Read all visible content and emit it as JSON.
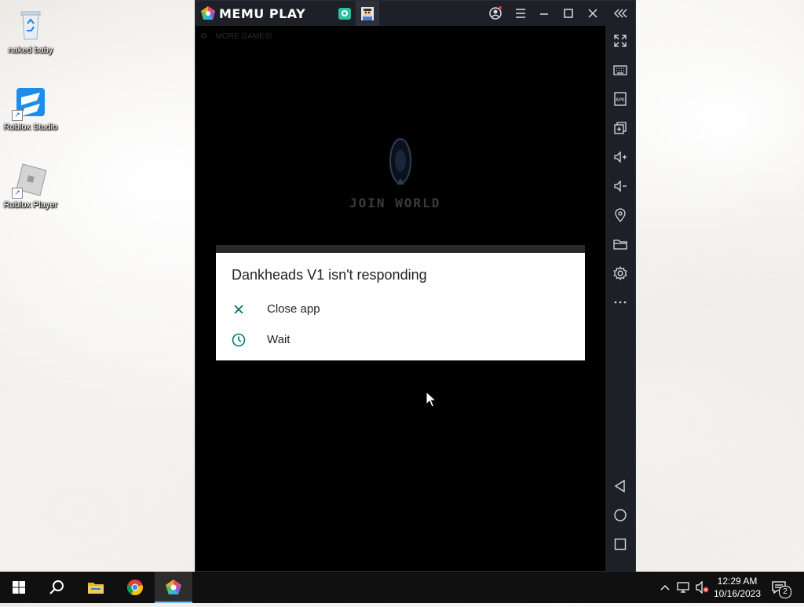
{
  "desktop": {
    "icons": [
      {
        "label": "naked baby",
        "icon": "recycle-bin-icon"
      },
      {
        "label": "Roblox Studio",
        "icon": "roblox-studio-icon"
      },
      {
        "label": "Roblox Player",
        "icon": "roblox-player-icon"
      }
    ]
  },
  "emulator": {
    "brand": "MEMU PLAY",
    "titlebar_buttons": [
      "account-icon",
      "menu-icon",
      "minimize-icon",
      "maximize-icon",
      "close-icon",
      "collapse-sidebar-icon"
    ],
    "sidebar_buttons": [
      "fullscreen-icon",
      "keyboard-icon",
      "apk-icon",
      "multi-instance-icon",
      "volume-up-icon",
      "volume-down-icon",
      "location-icon",
      "folder-icon",
      "settings-icon",
      "more-icon",
      "back-icon",
      "home-icon",
      "recents-icon"
    ],
    "game": {
      "toolbar_text": "MORE GAMES!",
      "center_text": "JOIN WORLD"
    },
    "dialog": {
      "title": "Dankheads V1 isn't responding",
      "options": [
        {
          "label": "Close app",
          "icon": "close-x-icon"
        },
        {
          "label": "Wait",
          "icon": "clock-icon"
        }
      ]
    }
  },
  "taskbar": {
    "apps": [
      "start-icon",
      "search-icon",
      "file-explorer-icon",
      "chrome-icon",
      "memu-icon"
    ],
    "clock": {
      "time": "12:29 AM",
      "date": "10/16/2023"
    },
    "notifications_count": "2"
  },
  "colors": {
    "accent_teal": "#00796b",
    "memu_dark": "#1d2026",
    "taskbar": "#101010"
  }
}
